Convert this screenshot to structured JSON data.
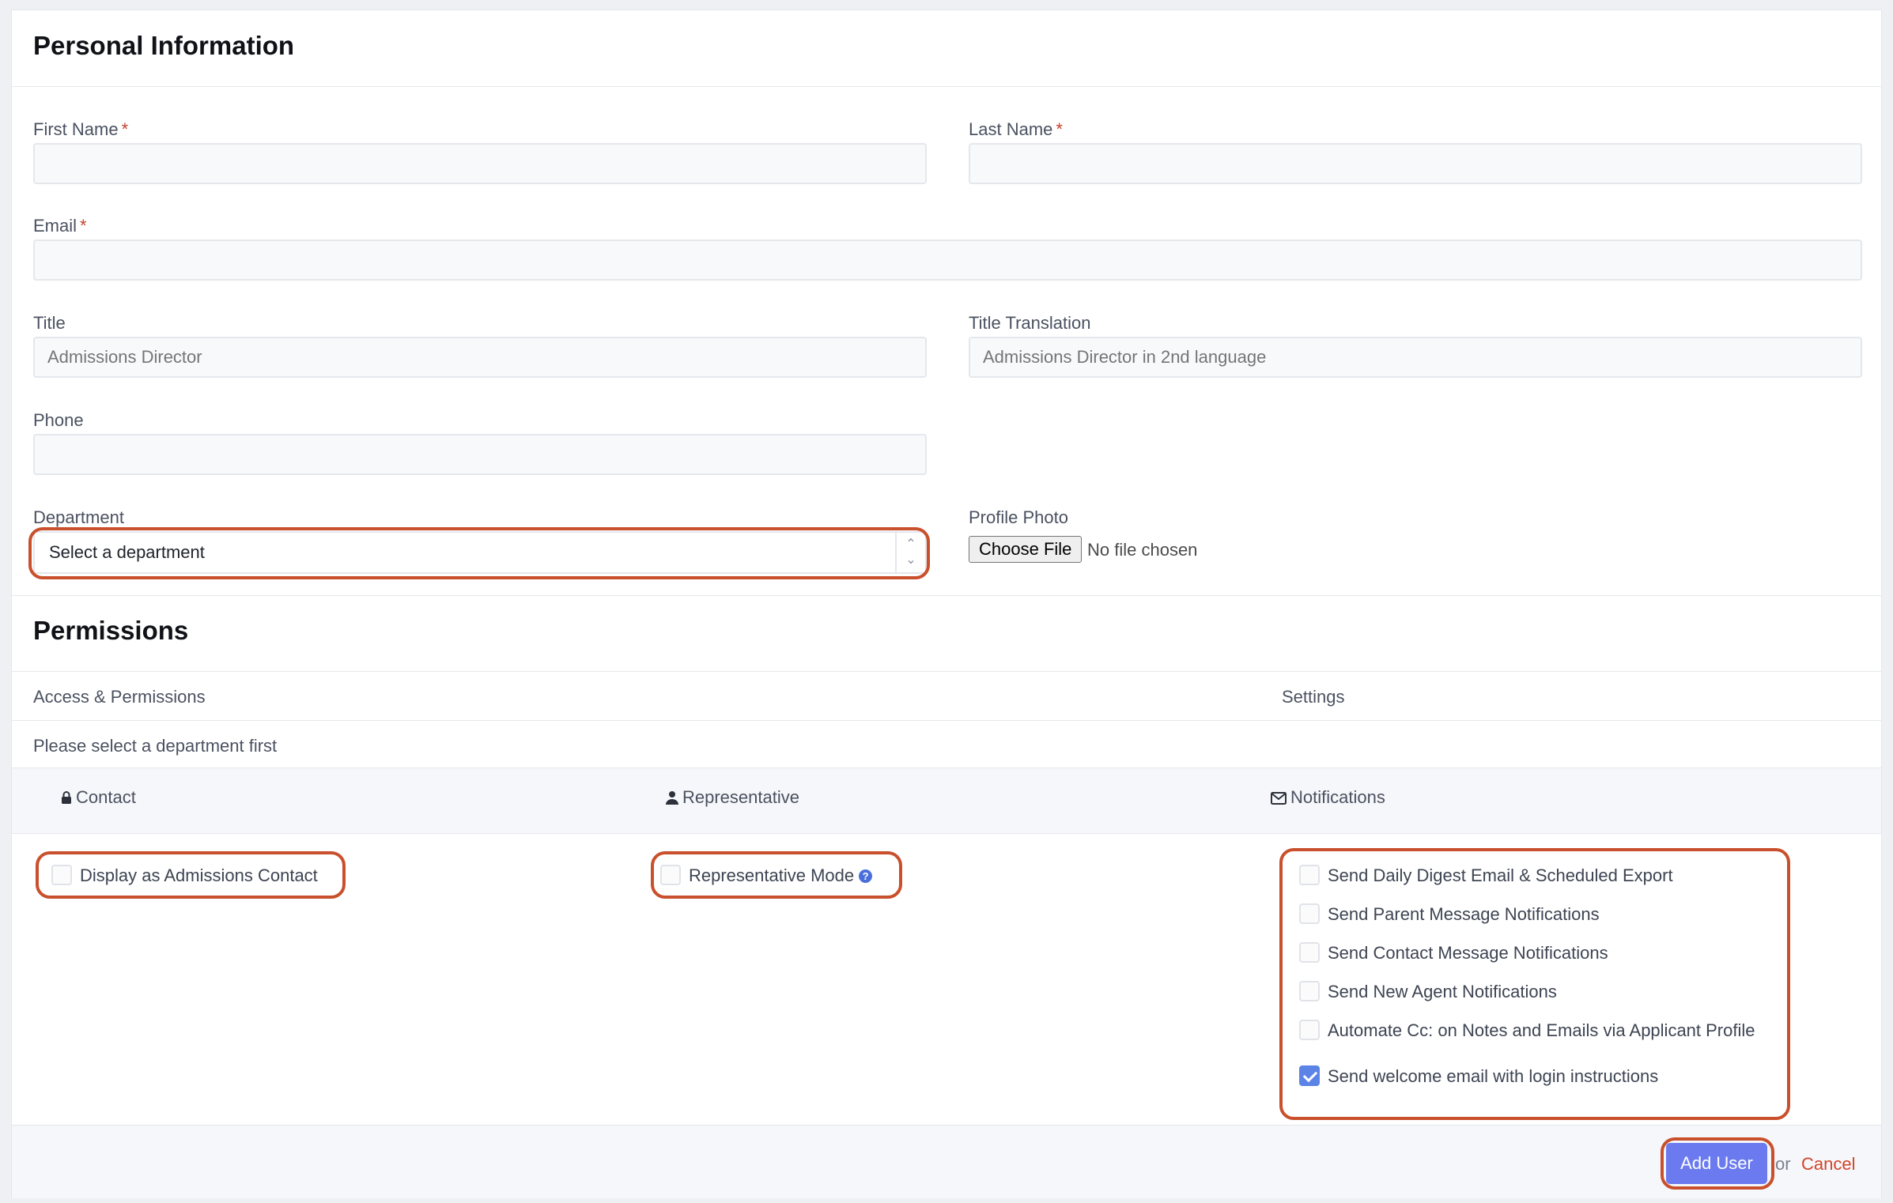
{
  "personal": {
    "heading": "Personal Information",
    "first_name_label": "First Name",
    "last_name_label": "Last Name",
    "email_label": "Email",
    "required_mark": "*",
    "title_label": "Title",
    "title_placeholder": "Admissions Director",
    "title_translation_label": "Title Translation",
    "title_translation_placeholder": "Admissions Director in 2nd language",
    "phone_label": "Phone",
    "department_label": "Department",
    "department_value": "Select a department",
    "profile_photo_label": "Profile Photo",
    "choose_file_label": "Choose File",
    "no_file_text": "No file chosen"
  },
  "permissions": {
    "heading": "Permissions",
    "col_access": "Access & Permissions",
    "col_settings": "Settings",
    "notice": "Please select a department first",
    "groups": {
      "contact": "Contact",
      "representative": "Representative",
      "notifications": "Notifications"
    },
    "contact_option": "Display as Admissions Contact",
    "representative_option": "Representative Mode",
    "notification_options": [
      {
        "label": "Send Daily Digest Email & Scheduled Export",
        "checked": false
      },
      {
        "label": "Send Parent Message Notifications",
        "checked": false
      },
      {
        "label": "Send Contact Message Notifications",
        "checked": false
      },
      {
        "label": "Send New Agent Notifications",
        "checked": false
      },
      {
        "label": "Automate Cc: on Notes and Emails via Applicant Profile",
        "checked": false
      },
      {
        "label": "Send welcome email with login instructions",
        "checked": true
      }
    ]
  },
  "footer": {
    "add_user_label": "Add User",
    "or_text": "or",
    "cancel_label": "Cancel"
  },
  "colors": {
    "accent": "#6b7bef",
    "highlight": "#c9502c",
    "checkbox_checked": "#5b84e6",
    "cancel": "#d2442a"
  }
}
